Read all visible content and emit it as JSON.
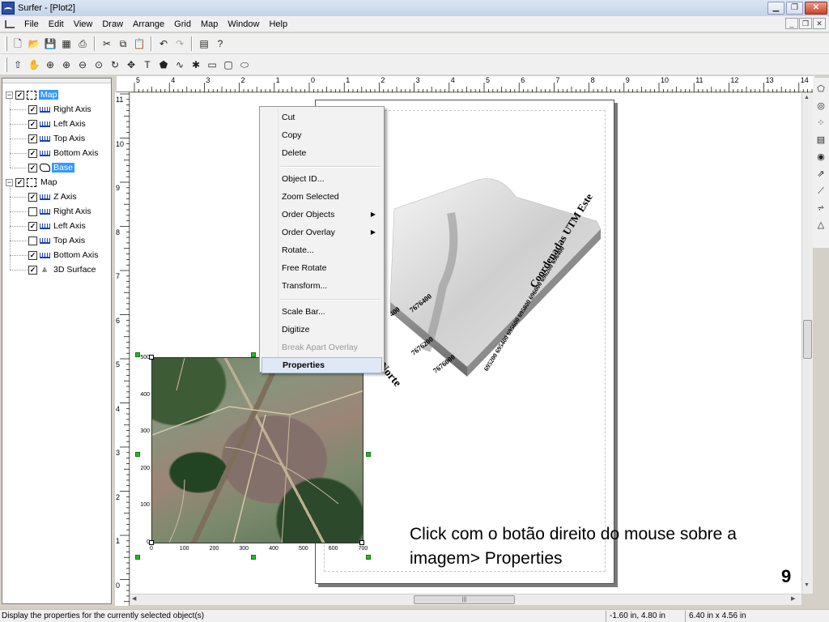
{
  "window": {
    "title": "Surfer - [Plot2]",
    "min": "▁",
    "max": "❐",
    "close": "✕"
  },
  "menubar": {
    "items": [
      "File",
      "Edit",
      "View",
      "Draw",
      "Arrange",
      "Grid",
      "Map",
      "Window",
      "Help"
    ],
    "mdi": [
      "_",
      "❐",
      "✕"
    ]
  },
  "toolbar1": {
    "icons": [
      "new-document-icon",
      "open-folder-icon",
      "save-icon",
      "worksheet-icon",
      "print-icon",
      "cut-icon",
      "copy-icon",
      "paste-icon",
      "undo-icon",
      "redo-icon",
      "object-manager-icon",
      "help-icon"
    ]
  },
  "toolbar2": {
    "icons": [
      "select-arrow-icon",
      "pan-hand-icon",
      "zoom-in-icon",
      "zoom-in-alt-icon",
      "zoom-out-icon",
      "zoom-page-icon",
      "rotate-icon",
      "move-icon",
      "text-tool-icon",
      "polygon-tool-icon",
      "polyline-tool-icon",
      "symbol-tool-icon",
      "rectangle-tool-icon",
      "rounded-rectangle-tool-icon",
      "ellipse-tool-icon"
    ]
  },
  "object_manager": {
    "items": [
      {
        "label": "Map",
        "level": 0,
        "checked": true,
        "icon": "map",
        "expander": "−",
        "selected": true
      },
      {
        "label": "Right Axis",
        "level": 1,
        "checked": true,
        "icon": "axis"
      },
      {
        "label": "Left Axis",
        "level": 1,
        "checked": true,
        "icon": "axis"
      },
      {
        "label": "Top Axis",
        "level": 1,
        "checked": true,
        "icon": "axis"
      },
      {
        "label": "Bottom Axis",
        "level": 1,
        "checked": true,
        "icon": "axis"
      },
      {
        "label": "Base",
        "level": 1,
        "checked": true,
        "icon": "base",
        "selected": true
      },
      {
        "label": "Map",
        "level": 0,
        "checked": true,
        "icon": "map",
        "expander": "−"
      },
      {
        "label": "Z Axis",
        "level": 1,
        "checked": true,
        "icon": "axis"
      },
      {
        "label": "Right Axis",
        "level": 1,
        "checked": false,
        "icon": "axis"
      },
      {
        "label": "Left Axis",
        "level": 1,
        "checked": true,
        "icon": "axis"
      },
      {
        "label": "Top Axis",
        "level": 1,
        "checked": false,
        "icon": "axis"
      },
      {
        "label": "Bottom Axis",
        "level": 1,
        "checked": true,
        "icon": "axis"
      },
      {
        "label": "3D Surface",
        "level": 1,
        "checked": true,
        "icon": "surface"
      }
    ]
  },
  "rulers": {
    "top": [
      "5",
      "4",
      "3",
      "2",
      "1",
      "0",
      "1",
      "2",
      "3",
      "4",
      "5",
      "6",
      "7",
      "8",
      "9",
      "10",
      "11",
      "12",
      "13",
      "14"
    ],
    "left": [
      "11",
      "10",
      "9",
      "8",
      "7",
      "6",
      "5",
      "4",
      "3",
      "2",
      "1",
      "0"
    ]
  },
  "context_menu": {
    "items": [
      {
        "label": "Cut"
      },
      {
        "label": "Copy"
      },
      {
        "label": "Delete"
      },
      {
        "separator": true
      },
      {
        "label": "Object ID..."
      },
      {
        "label": "Zoom Selected"
      },
      {
        "label": "Order Objects",
        "submenu": true
      },
      {
        "label": "Order Overlay",
        "submenu": true
      },
      {
        "label": "Rotate..."
      },
      {
        "label": "Free Rotate"
      },
      {
        "label": "Transform..."
      },
      {
        "separator": true
      },
      {
        "label": "Scale Bar..."
      },
      {
        "label": "Digitize"
      },
      {
        "label": "Break Apart Overlay",
        "disabled": true
      },
      {
        "label": "Properties",
        "highlighted": true
      }
    ]
  },
  "surface_labels": {
    "right_axis_title": "Coordenadas UTM Este",
    "right_axis_ticks": "695200 695400 695600 695800 696000 696200 696400",
    "left_axis_ticks": [
      "7676400",
      "7676200",
      "7676000"
    ],
    "left_axis_partial": "400",
    "left_axis_title": "Norte"
  },
  "satellite_axes": {
    "y_ticks": [
      "500",
      "400",
      "300",
      "200",
      "100",
      "0"
    ],
    "x_ticks": [
      "0",
      "100",
      "200",
      "300",
      "400",
      "500",
      "600",
      "700"
    ]
  },
  "instruction": "Click com o botão direito do mouse  sobre a imagem> Properties",
  "page_number": "9",
  "status": {
    "message": "Display the properties for the currently selected object(s)",
    "position": "-1.60 in, 4.80 in",
    "size": "6.40 in x 4.56 in"
  },
  "right_tools": [
    "new-base-map-icon",
    "new-contour-map-icon",
    "new-post-map-icon",
    "new-image-map-icon",
    "new-shaded-relief-icon",
    "new-vector-map-icon",
    "new-wireframe-icon",
    "new-surface-icon",
    "new-3d-surface-icon"
  ],
  "colors": {
    "selection": "#3399ff",
    "menu_highlight": "#dfe8f5",
    "handle": "#22bb22"
  }
}
